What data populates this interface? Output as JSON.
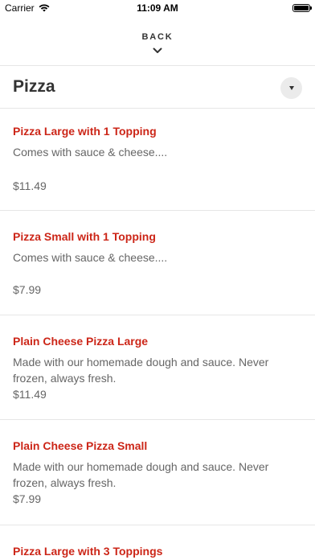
{
  "status_bar": {
    "carrier": "Carrier",
    "time": "11:09 AM"
  },
  "nav": {
    "back_label": "BACK"
  },
  "section": {
    "title": "Pizza"
  },
  "items": [
    {
      "name": "Pizza Large with 1 Topping",
      "description": "Comes with sauce & cheese....",
      "price": "$11.49"
    },
    {
      "name": "Pizza Small with 1 Topping",
      "description": "Comes with sauce & cheese....",
      "price": "$7.99"
    },
    {
      "name": "Plain Cheese Pizza Large",
      "description": "Made with our homemade dough and sauce. Never frozen, always fresh.",
      "price": "$11.49"
    },
    {
      "name": "Plain Cheese Pizza Small",
      "description": "Made with our homemade dough and sauce. Never frozen, always fresh.",
      "price": "$7.99"
    },
    {
      "name": "Pizza Large with 3 Toppings",
      "description": "",
      "price": ""
    }
  ]
}
